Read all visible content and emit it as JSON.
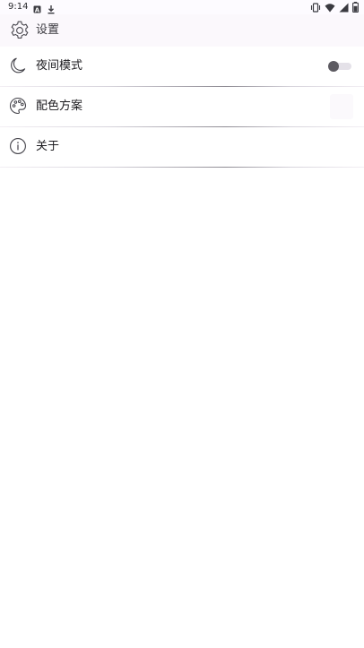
{
  "status_bar": {
    "time": "9:14",
    "left_icons": [
      "accessibility-a-icon",
      "download-icon"
    ],
    "right_icons": [
      "vibrate-icon",
      "wifi-icon",
      "signal-icon",
      "battery-icon"
    ]
  },
  "app_bar": {
    "icon": "gear-icon",
    "title": "设置"
  },
  "settings": {
    "items": [
      {
        "icon": "moon-icon",
        "label": "夜间模式",
        "control": "toggle",
        "toggle_on": false
      },
      {
        "icon": "palette-icon",
        "label": "配色方案"
      },
      {
        "icon": "info-icon",
        "label": "关于"
      }
    ]
  },
  "colors": {
    "background": "#ffffff",
    "app_bar_background": "#fbf8fc",
    "text_primary": "#1c1b1f",
    "toggle_thumb": "#5c5a61",
    "toggle_track": "#e4e1e8"
  }
}
